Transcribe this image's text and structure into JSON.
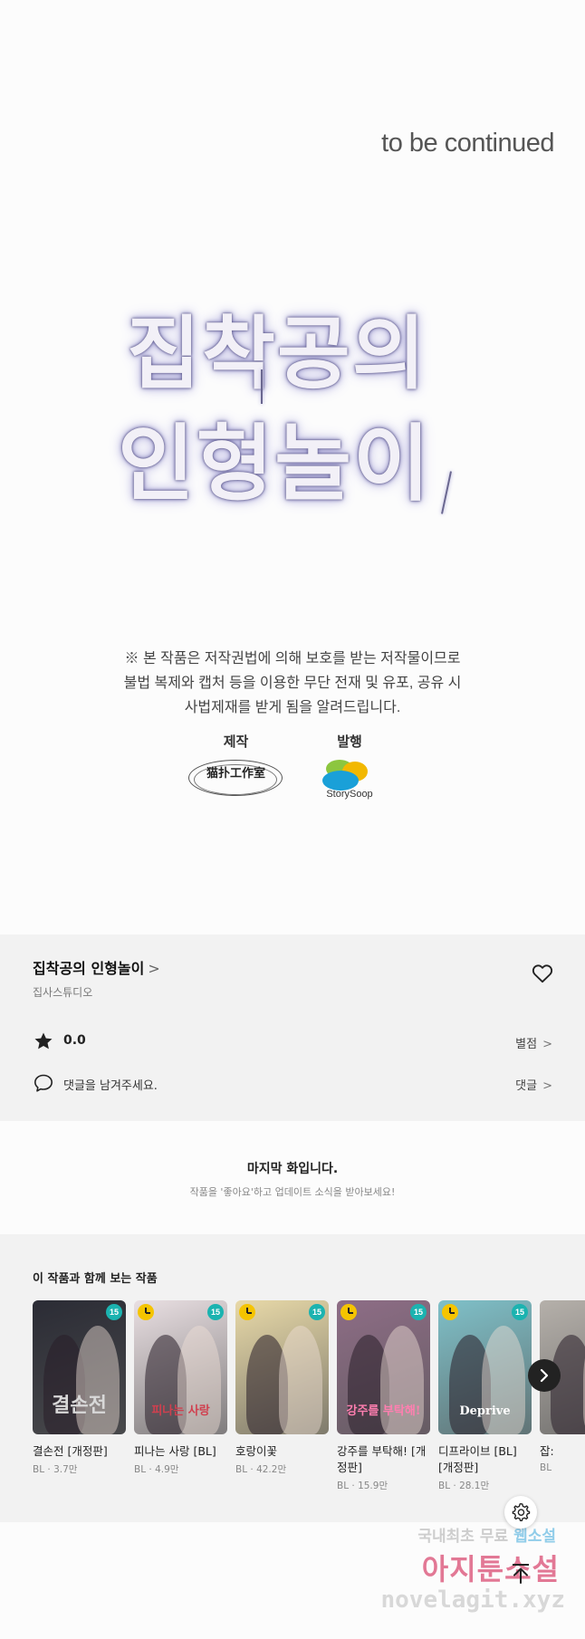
{
  "panel": {
    "to_be_continued": "to be continued",
    "logo_line1": "집착공의",
    "logo_line2": "인형놀이",
    "notice_lines": [
      "※ 본 작품은 저작권법에 의해 보호를 받는 저작물이므로",
      "불법 복제와 캡처 등을  이용한 무단 전재 및 유포, 공유 시",
      "사법제재를  받게 됨을 알려드립니다."
    ],
    "credits": {
      "production_label": "제작",
      "production_name": "猫扑工作室",
      "publisher_label": "발행",
      "publisher_name": "StorySoop"
    }
  },
  "info": {
    "title": "집착공의 인형놀이",
    "title_chevron": ">",
    "author": "집사스튜디오",
    "rating_value": "0.0",
    "rating_link": "별점",
    "comment_prompt": "댓글을 남겨주세요.",
    "comment_link": "댓글",
    "chevron": ">"
  },
  "last_episode": {
    "heading": "마지막 화입니다.",
    "subtext": "작품을 '좋아요'하고 업데이트 소식을 받아보세요!"
  },
  "recommendations": {
    "heading": "이 작품과 함께 보는 작품",
    "items": [
      {
        "name": "결손전 [개정판]",
        "meta": "BL · 3.7만",
        "cover_text": "결손전",
        "badge": "15",
        "waitfree": false,
        "bg": "#2b2c35",
        "accent": "#d8d8d8"
      },
      {
        "name": "피나는 사랑 [BL]",
        "meta": "BL · 4.9만",
        "cover_text": "피나는 사랑",
        "badge": "15",
        "waitfree": true,
        "bg": "#e9dfe2",
        "accent": "#d0404f"
      },
      {
        "name": "호랑이꽃",
        "meta": "BL · 42.2만",
        "cover_text": "",
        "badge": "15",
        "waitfree": true,
        "bg": "#e8d9a8",
        "accent": "#3d5a8c"
      },
      {
        "name": "강주를 부탁해! [개정판]",
        "meta": "BL · 15.9만",
        "cover_text": "강주를 부탁해!",
        "badge": "15",
        "waitfree": true,
        "bg": "#8e6d86",
        "accent": "#ff7fb0"
      },
      {
        "name": "디프라이브 [BL] [개정판]",
        "meta": "BL · 28.1만",
        "cover_text": "Deprive",
        "badge": "15",
        "waitfree": true,
        "bg": "#7fc0c8",
        "accent": "#ffffff"
      },
      {
        "name": "잡:",
        "meta": "BL",
        "cover_text": "",
        "badge": "",
        "waitfree": false,
        "bg": "#b5b0aa",
        "accent": "#ffffff"
      }
    ]
  },
  "watermark": {
    "line1_prefix": "국내최초 무료 ",
    "line1_highlight": "웹소설",
    "line2": "아지툰소설",
    "line3": "novelagit.xyz"
  },
  "icons": {
    "heart": "heart-icon",
    "star": "star-icon",
    "comment": "comment-bubble-icon",
    "next": "chevron-right-icon",
    "settings": "gear-icon",
    "top": "arrow-up-to-top-icon"
  }
}
